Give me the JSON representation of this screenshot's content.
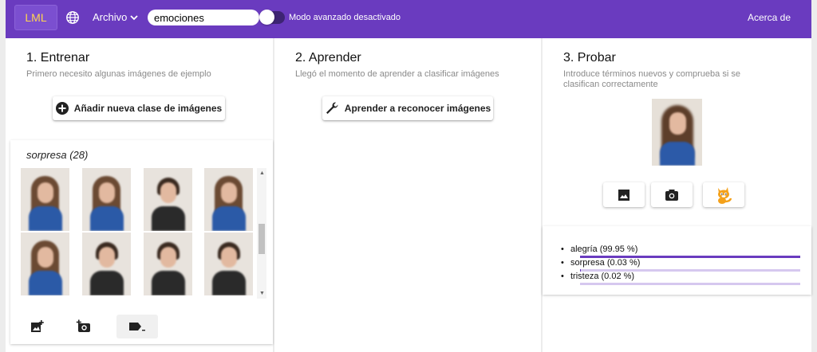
{
  "header": {
    "logo": "LML",
    "menu_file": "Archivo",
    "project_name": "emociones",
    "mode_label": "Modo avanzado desactivado",
    "about": "Acerca de"
  },
  "train": {
    "title": "1. Entrenar",
    "subtitle": "Primero necesito algunas imágenes de ejemplo",
    "add_class_button": "Añadir nueva clase de imágenes",
    "class_card": {
      "title": "sorpresa (28)"
    }
  },
  "learn": {
    "title": "2. Aprender",
    "subtitle": "Llegó el momento de aprender a clasificar imágenes",
    "learn_button": "Aprender a reconocer imágenes"
  },
  "test": {
    "title": "3. Probar",
    "subtitle": "Introduce términos nuevos y comprueba si se clasifican correctamente",
    "results": [
      {
        "label": "alegría (99.95 %)",
        "value": 99.95
      },
      {
        "label": "sorpresa (0.03 %)",
        "value": 0.03
      },
      {
        "label": "tristeza (0.02 %)",
        "value": 0.02
      }
    ]
  },
  "colors": {
    "accent": "#6a3bbf",
    "logo_text": "#ffd54f"
  }
}
